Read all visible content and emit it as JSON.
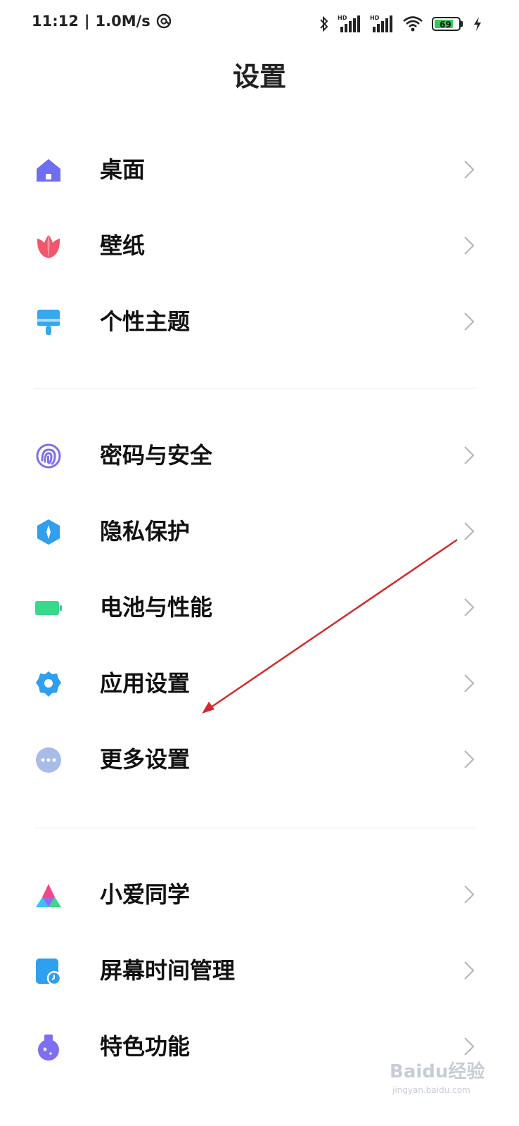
{
  "status_bar": {
    "time": "11:12",
    "speed": "1.0M/s",
    "battery": "69",
    "icons": [
      "data-saver-icon",
      "bluetooth-icon",
      "hd-signal-icon",
      "hd-signal-icon",
      "wifi-icon",
      "battery-icon",
      "charging-bolt-icon"
    ]
  },
  "header": {
    "title": "设置"
  },
  "groups": [
    [
      {
        "label": "桌面",
        "icon": "home-icon"
      },
      {
        "label": "壁纸",
        "icon": "tulip-icon"
      },
      {
        "label": "个性主题",
        "icon": "paintbrush-icon"
      }
    ],
    [
      {
        "label": "密码与安全",
        "icon": "fingerprint-icon"
      },
      {
        "label": "隐私保护",
        "icon": "privacy-shield-icon"
      },
      {
        "label": "电池与性能",
        "icon": "battery-icon"
      },
      {
        "label": "应用设置",
        "icon": "gear-icon"
      },
      {
        "label": "更多设置",
        "icon": "more-dots-icon"
      }
    ],
    [
      {
        "label": "小爱同学",
        "icon": "xiaoai-icon"
      },
      {
        "label": "屏幕时间管理",
        "icon": "screen-time-icon"
      },
      {
        "label": "特色功能",
        "icon": "flask-icon"
      }
    ]
  ],
  "colors": {
    "home": "#6f6df0",
    "tulip": "#f0576e",
    "brush": "#35a8ef",
    "fingerprint": "#7d6ff0",
    "shield": "#2f9ff0",
    "battery": "#37d98a",
    "gear": "#2f9ff0",
    "more": "#a9bbe8",
    "screen_time": "#2f9ff0",
    "flask": "#7d6ff0",
    "chevron": "#b8b8b8",
    "arrow": "#d22a2a"
  },
  "watermark": {
    "text": "Baidu经验",
    "sub": "jingyan.baidu.com"
  }
}
